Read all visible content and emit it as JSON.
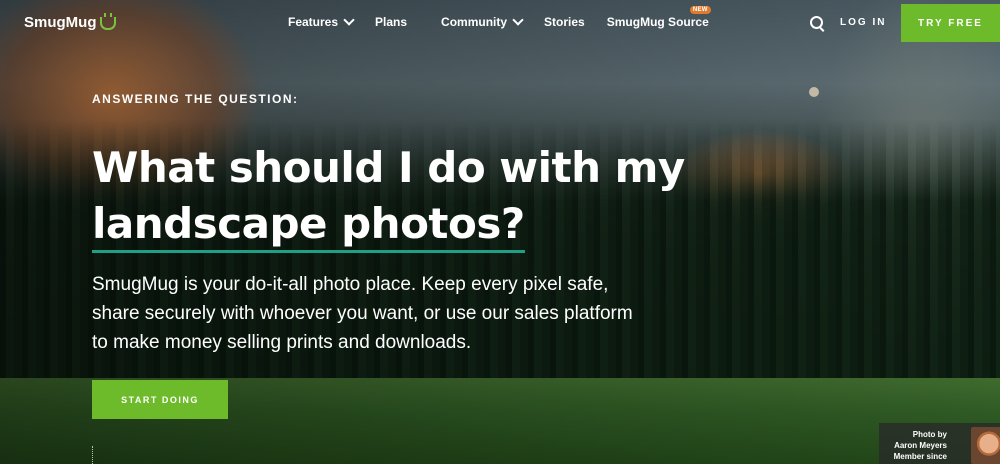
{
  "nav": {
    "logo": "SmugMug",
    "links": [
      {
        "label": "Features",
        "dropdown": true
      },
      {
        "label": "Plans",
        "dropdown": false
      },
      {
        "label": "Community",
        "dropdown": true
      },
      {
        "label": "Stories",
        "dropdown": false
      },
      {
        "label": "SmugMug Source",
        "dropdown": false,
        "badge": "NEW"
      }
    ],
    "login": "LOG IN",
    "cta": "TRY FREE"
  },
  "hero": {
    "eyebrow": "ANSWERING THE QUESTION:",
    "headline_part1": "What should I do with my",
    "headline_highlight": "landscape photos?",
    "lede": "SmugMug is your do-it-all photo place. Keep every pixel safe, share securely with whoever you want, or use our sales platform to make money selling prints and downloads.",
    "cta": "START DOING"
  },
  "credit": {
    "line1": "Photo by",
    "line2": "Aaron Meyers",
    "line3": "Member since"
  },
  "colors": {
    "accent_green": "#6dbb2a",
    "underline_teal": "#1f9f86",
    "badge_orange": "#e07a2e"
  }
}
